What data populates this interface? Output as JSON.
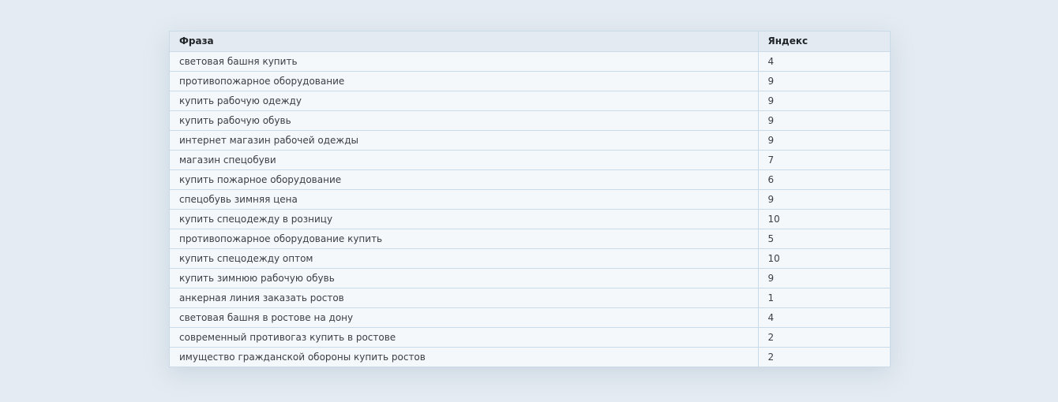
{
  "table": {
    "columns": [
      "Фраза",
      "Яндекс"
    ],
    "rows": [
      {
        "phrase": "световая башня купить",
        "yandex": "4"
      },
      {
        "phrase": "противопожарное оборудование",
        "yandex": "9"
      },
      {
        "phrase": "купить рабочую одежду",
        "yandex": "9"
      },
      {
        "phrase": "купить рабочую обувь",
        "yandex": "9"
      },
      {
        "phrase": "интернет магазин рабочей одежды",
        "yandex": "9"
      },
      {
        "phrase": "магазин спецобуви",
        "yandex": "7"
      },
      {
        "phrase": "купить пожарное оборудование",
        "yandex": "6"
      },
      {
        "phrase": "спецобувь зимняя цена",
        "yandex": "9"
      },
      {
        "phrase": "купить спецодежду в розницу",
        "yandex": "10"
      },
      {
        "phrase": "противопожарное оборудование купить",
        "yandex": "5"
      },
      {
        "phrase": "купить спецодежду оптом",
        "yandex": "10"
      },
      {
        "phrase": "купить зимнюю рабочую обувь",
        "yandex": "9"
      },
      {
        "phrase": "анкерная линия заказать ростов",
        "yandex": "1"
      },
      {
        "phrase": "световая башня в ростове на дону",
        "yandex": "4"
      },
      {
        "phrase": "современный противогаз купить в ростове",
        "yandex": "2"
      },
      {
        "phrase": "имущество гражданской обороны купить ростов",
        "yandex": "2"
      }
    ]
  },
  "colors": {
    "background": "#e4ebf2",
    "header_bg": "#e3eaf1",
    "row_bg": "#f5f8fb",
    "border": "#c9dbe9"
  }
}
